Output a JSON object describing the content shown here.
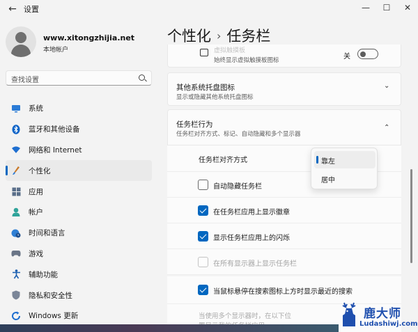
{
  "window": {
    "title": "设置",
    "back_glyph": "←",
    "min_glyph": "—",
    "max_glyph": "☐",
    "close_glyph": "✕"
  },
  "account": {
    "name": "www.xitongzhijia.net",
    "type": "本地帐户"
  },
  "search": {
    "placeholder": "查找设置"
  },
  "sidebar": {
    "items": [
      {
        "label": "系统",
        "icon": "monitor-icon",
        "active": false
      },
      {
        "label": "蓝牙和其他设备",
        "icon": "bluetooth-icon",
        "active": false
      },
      {
        "label": "网络和 Internet",
        "icon": "wifi-icon",
        "active": false
      },
      {
        "label": "个性化",
        "icon": "brush-icon",
        "active": true
      },
      {
        "label": "应用",
        "icon": "apps-icon",
        "active": false
      },
      {
        "label": "帐户",
        "icon": "person-icon",
        "active": false
      },
      {
        "label": "时间和语言",
        "icon": "globe-clock-icon",
        "active": false
      },
      {
        "label": "游戏",
        "icon": "gamepad-icon",
        "active": false
      },
      {
        "label": "辅助功能",
        "icon": "accessibility-icon",
        "active": false
      },
      {
        "label": "隐私和安全性",
        "icon": "shield-icon",
        "active": false
      },
      {
        "label": "Windows 更新",
        "icon": "update-icon",
        "active": false
      }
    ]
  },
  "header": {
    "parent": "个性化",
    "separator": "›",
    "current": "任务栏"
  },
  "cards": {
    "touch_keyboard": {
      "title": "虚拟触摸板",
      "desc": "始终显示虚拟触摸板图标",
      "toggle_label": "关",
      "toggle_on": false
    },
    "other_tray": {
      "title": "其他系统托盘图标",
      "desc": "显示或隐藏其他系统托盘图标",
      "chevron": "⌄"
    },
    "behaviors": {
      "title": "任务栏行为",
      "desc": "任务栏对齐方式、标记、自动隐藏和多个显示器",
      "chevron": "⌃"
    }
  },
  "behaviors": {
    "alignment_label": "任务栏对齐方式",
    "options": [
      {
        "label": "自动隐藏任务栏",
        "checked": false,
        "disabled": false
      },
      {
        "label": "在任务栏应用上显示徽章",
        "checked": true,
        "disabled": false
      },
      {
        "label": "显示任务栏应用上的闪烁",
        "checked": true,
        "disabled": false
      },
      {
        "label": "在所有显示器上显示任务栏",
        "checked": false,
        "disabled": true
      },
      {
        "label": "当鼠标悬停在搜索图标上方时显示最近的搜索",
        "checked": true,
        "disabled": false
      }
    ],
    "multi_display_line1": "当使用多个显示器时，在以下位",
    "multi_display_line2": "置显示我的任务栏应用"
  },
  "dropdown": {
    "options": [
      "靠左",
      "居中"
    ],
    "selected": "靠左"
  },
  "watermark": {
    "name": "鹿大师",
    "url": "Ludashiwj.com"
  },
  "colors": {
    "accent": "#0067c0",
    "background": "#f3f3f3",
    "card": "#fbfbfb",
    "watermark": "#1f4fae"
  }
}
